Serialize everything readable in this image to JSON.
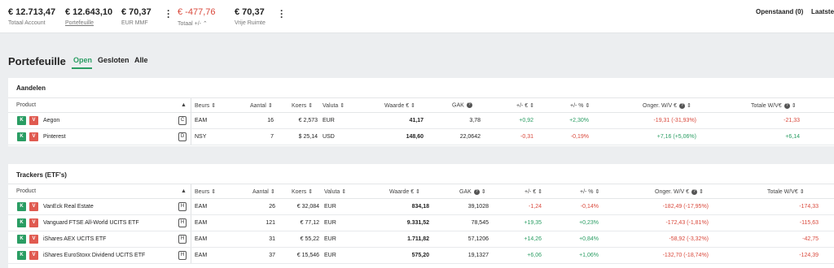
{
  "topbar": {
    "stats": [
      {
        "value": "€ 12.713,47",
        "label": "Totaal Account"
      },
      {
        "value": "€ 12.643,10",
        "label": "Portefeuille"
      },
      {
        "value": "€ 70,37",
        "label": "EUR MMF"
      },
      {
        "value": "€ -477,76",
        "label": "Totaal +/- ⌃"
      },
      {
        "value": "€ 70,37",
        "label": "Vrije Ruimte"
      }
    ],
    "openstaand": "Openstaand (0)",
    "laatste": "Laatste"
  },
  "portfolio": {
    "title": "Portefeuille",
    "tabs": [
      "Open",
      "Gesloten",
      "Alle"
    ]
  },
  "colors": {
    "accent": "#2a9d63",
    "negative": "#d9483b",
    "sell": "#e05a50"
  },
  "icons": {
    "sort": "sort-icon",
    "help": "help-icon",
    "kebab": "kebab-menu-icon"
  },
  "aandelen": {
    "title": "Aandelen",
    "headers": {
      "product": "Product",
      "beurs": "Beurs",
      "aantal": "Aantal",
      "koers": "Koers",
      "valuta": "Valuta",
      "waarde": "Waarde €",
      "gak": "GAK",
      "pm_eur": "+/- €",
      "pm_pct": "+/- %",
      "onger": "Onger. W/V €",
      "totale": "Totale W/V€"
    },
    "rows": [
      {
        "buy": "K",
        "sell": "V",
        "product": "Aegon",
        "badge": "C",
        "beurs": "EAM",
        "aantal": "16",
        "koers": "€ 2,573",
        "valuta": "EUR",
        "waarde": "41,17",
        "gak": "3,78",
        "pm_eur": "+0,92",
        "pm_pct": "+2,30%",
        "onger": "-19,31 (-31,93%)",
        "totale": "-21,33"
      },
      {
        "buy": "K",
        "sell": "V",
        "product": "Pinterest",
        "badge": "D",
        "beurs": "NSY",
        "aantal": "7",
        "koers": "$ 25,14",
        "valuta": "USD",
        "waarde": "148,60",
        "gak": "22,0642",
        "pm_eur": "-0,31",
        "pm_pct": "-0,19%",
        "onger": "+7,16 (+5,06%)",
        "totale": "+6,14"
      }
    ]
  },
  "trackers": {
    "title": "Trackers (ETF's)",
    "headers": {
      "product": "Product",
      "beurs": "Beurs",
      "aantal": "Aantal",
      "koers": "Koers",
      "valuta": "Valuta",
      "waarde": "Waarde €",
      "gak": "GAK",
      "pm_eur": "+/- €",
      "pm_pct": "+/- %",
      "onger": "Onger. W/V €",
      "totale": "Totale W/V€"
    },
    "rows": [
      {
        "buy": "K",
        "sell": "V",
        "product": "VanEck Real Estate",
        "badge": "H",
        "beurs": "EAM",
        "aantal": "26",
        "koers": "€ 32,084",
        "valuta": "EUR",
        "waarde": "834,18",
        "gak": "39,1028",
        "pm_eur": "-1,24",
        "pm_pct": "-0,14%",
        "onger": "-182,49 (-17,95%)",
        "totale": "-174,33"
      },
      {
        "buy": "K",
        "sell": "V",
        "product": "Vanguard FTSE All-World UCITS ETF",
        "badge": "H",
        "beurs": "EAM",
        "aantal": "121",
        "koers": "€ 77,12",
        "valuta": "EUR",
        "waarde": "9.331,52",
        "gak": "78,545",
        "pm_eur": "+19,35",
        "pm_pct": "+0,23%",
        "onger": "-172,43 (-1,81%)",
        "totale": "-115,63"
      },
      {
        "buy": "K",
        "sell": "V",
        "product": "iShares AEX UCITS ETF",
        "badge": "H",
        "beurs": "EAM",
        "aantal": "31",
        "koers": "€ 55,22",
        "valuta": "EUR",
        "waarde": "1.711,82",
        "gak": "57,1206",
        "pm_eur": "+14,26",
        "pm_pct": "+0,84%",
        "onger": "-58,92 (-3,32%)",
        "totale": "-42,75"
      },
      {
        "buy": "K",
        "sell": "V",
        "product": "iShares EuroStoxx Dividend UCITS ETF",
        "badge": "H",
        "beurs": "EAM",
        "aantal": "37",
        "koers": "€ 15,546",
        "valuta": "EUR",
        "waarde": "575,20",
        "gak": "19,1327",
        "pm_eur": "+6,06",
        "pm_pct": "+1,06%",
        "onger": "-132,70 (-18,74%)",
        "totale": "-124,39"
      }
    ]
  }
}
